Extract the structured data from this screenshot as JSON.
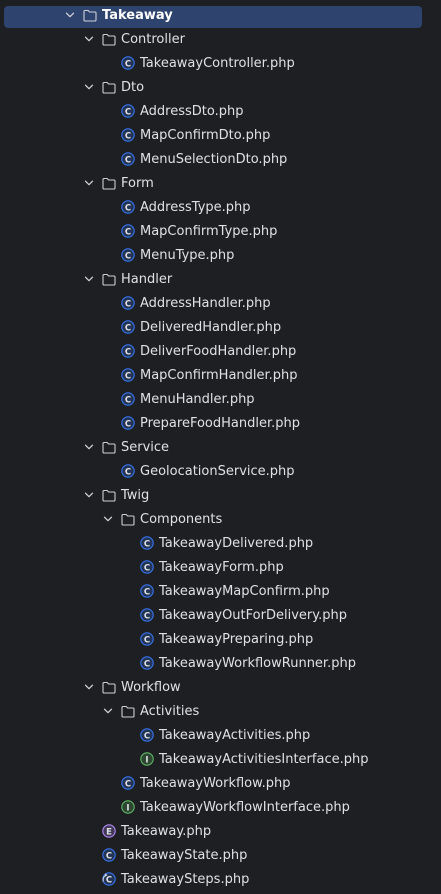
{
  "colors": {
    "background": "#1e1f22",
    "selection": "#2e436e",
    "text": "#dfe1e5",
    "class_icon": "#3574f0",
    "interface_icon": "#5fb865",
    "enum_icon": "#b189f5",
    "folder_icon": "#ced0d6"
  },
  "tree": [
    {
      "label": "Takeaway",
      "kind": "folder",
      "depth": 0,
      "expanded": true,
      "selected": true
    },
    {
      "label": "Controller",
      "kind": "folder",
      "depth": 1,
      "expanded": true
    },
    {
      "label": "TakeawayController.php",
      "kind": "class",
      "depth": 2
    },
    {
      "label": "Dto",
      "kind": "folder",
      "depth": 1,
      "expanded": true
    },
    {
      "label": "AddressDto.php",
      "kind": "class",
      "depth": 2
    },
    {
      "label": "MapConfirmDto.php",
      "kind": "class",
      "depth": 2
    },
    {
      "label": "MenuSelectionDto.php",
      "kind": "class",
      "depth": 2
    },
    {
      "label": "Form",
      "kind": "folder",
      "depth": 1,
      "expanded": true
    },
    {
      "label": "AddressType.php",
      "kind": "class",
      "depth": 2
    },
    {
      "label": "MapConfirmType.php",
      "kind": "class",
      "depth": 2
    },
    {
      "label": "MenuType.php",
      "kind": "class",
      "depth": 2
    },
    {
      "label": "Handler",
      "kind": "folder",
      "depth": 1,
      "expanded": true
    },
    {
      "label": "AddressHandler.php",
      "kind": "class",
      "depth": 2
    },
    {
      "label": "DeliveredHandler.php",
      "kind": "class",
      "depth": 2
    },
    {
      "label": "DeliverFoodHandler.php",
      "kind": "class",
      "depth": 2
    },
    {
      "label": "MapConfirmHandler.php",
      "kind": "class",
      "depth": 2
    },
    {
      "label": "MenuHandler.php",
      "kind": "class",
      "depth": 2
    },
    {
      "label": "PrepareFoodHandler.php",
      "kind": "class",
      "depth": 2
    },
    {
      "label": "Service",
      "kind": "folder",
      "depth": 1,
      "expanded": true
    },
    {
      "label": "GeolocationService.php",
      "kind": "class",
      "depth": 2
    },
    {
      "label": "Twig",
      "kind": "folder",
      "depth": 1,
      "expanded": true
    },
    {
      "label": "Components",
      "kind": "folder",
      "depth": 2,
      "expanded": true
    },
    {
      "label": "TakeawayDelivered.php",
      "kind": "class",
      "depth": 3
    },
    {
      "label": "TakeawayForm.php",
      "kind": "class",
      "depth": 3
    },
    {
      "label": "TakeawayMapConfirm.php",
      "kind": "class",
      "depth": 3
    },
    {
      "label": "TakeawayOutForDelivery.php",
      "kind": "class",
      "depth": 3
    },
    {
      "label": "TakeawayPreparing.php",
      "kind": "class",
      "depth": 3
    },
    {
      "label": "TakeawayWorkflowRunner.php",
      "kind": "class",
      "depth": 3
    },
    {
      "label": "Workflow",
      "kind": "folder",
      "depth": 1,
      "expanded": true
    },
    {
      "label": "Activities",
      "kind": "folder",
      "depth": 2,
      "expanded": true
    },
    {
      "label": "TakeawayActivities.php",
      "kind": "class",
      "depth": 3
    },
    {
      "label": "TakeawayActivitiesInterface.php",
      "kind": "interface",
      "depth": 3
    },
    {
      "label": "TakeawayWorkflow.php",
      "kind": "class",
      "depth": 2
    },
    {
      "label": "TakeawayWorkflowInterface.php",
      "kind": "interface",
      "depth": 2
    },
    {
      "label": "Takeaway.php",
      "kind": "enum",
      "depth": 1
    },
    {
      "label": "TakeawayState.php",
      "kind": "class",
      "depth": 1
    },
    {
      "label": "TakeawaySteps.php",
      "kind": "class-alt",
      "depth": 1
    }
  ]
}
